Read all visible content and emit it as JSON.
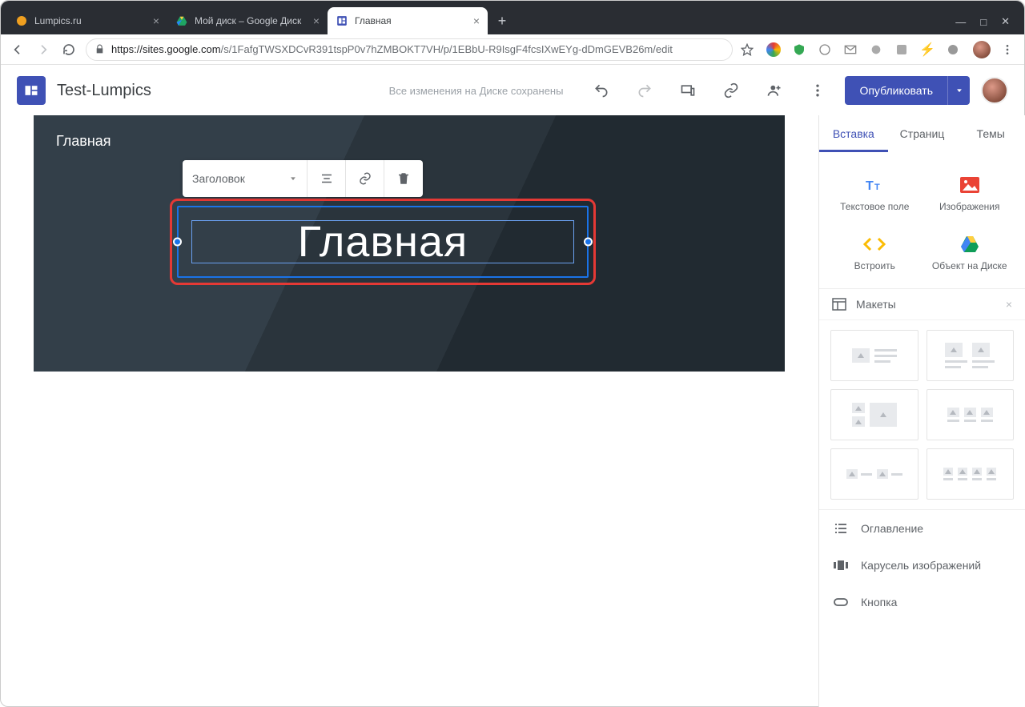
{
  "browser": {
    "tabs": [
      {
        "label": "Lumpics.ru"
      },
      {
        "label": "Мой диск – Google Диск"
      },
      {
        "label": "Главная"
      }
    ],
    "url_domain": "https://sites.google.com",
    "url_path": "/s/1FafgTWSXDCvR391tspP0v7hZMBOKT7VH/p/1EBbU-R9IsgF4fcsIXwEYg-dDmGEVB26m/edit"
  },
  "app": {
    "site_name": "Test-Lumpics",
    "save_status": "Все изменения на Диске сохранены",
    "publish": "Опубликовать"
  },
  "page": {
    "label": "Главная",
    "title_text": "Главная"
  },
  "floatbar": {
    "style_label": "Заголовок"
  },
  "sidebar": {
    "tabs": {
      "insert": "Вставка",
      "pages": "Страниц",
      "themes": "Темы"
    },
    "insert": {
      "text": "Текстовое поле",
      "images": "Изображения",
      "embed": "Встроить",
      "drive": "Объект на Диске"
    },
    "layouts_label": "Макеты",
    "items": {
      "toc": "Оглавление",
      "carousel": "Карусель изображений",
      "button": "Кнопка"
    }
  }
}
